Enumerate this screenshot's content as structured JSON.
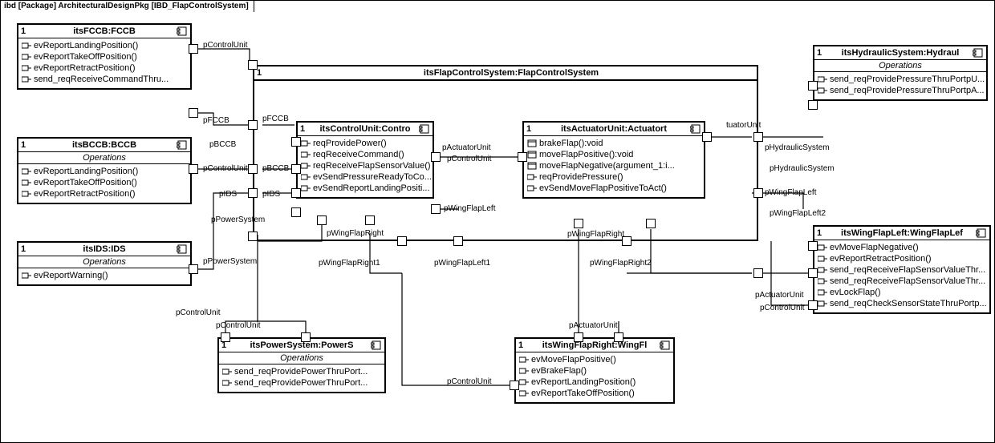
{
  "header": "ibd [Package] ArchitecturalDesignPkg [IBD_FlapControlSystem]",
  "frame": {
    "mult": "1",
    "title": "itsFlapControlSystem:FlapControlSystem"
  },
  "blocks": {
    "fccb": {
      "mult": "1",
      "title": "itsFCCB:FCCB",
      "ops": [
        "evReportLandingPosition()",
        "evReportTakeOffPosition()",
        "evReportRetractPosition()",
        "send_reqReceiveCommandThru..."
      ]
    },
    "bccb": {
      "mult": "1",
      "title": "itsBCCB:BCCB",
      "ops_header": "Operations",
      "ops": [
        "evReportLandingPosition()",
        "evReportTakeOffPosition()",
        "evReportRetractPosition()"
      ]
    },
    "ids": {
      "mult": "1",
      "title": "itsIDS:IDS",
      "ops_header": "Operations",
      "ops": [
        "evReportWarning()"
      ]
    },
    "controlunit": {
      "mult": "1",
      "title": "itsControlUnit:Contro",
      "ops": [
        "reqProvidePower()",
        "reqReceiveCommand()",
        "reqReceiveFlapSensorValue()",
        "evSendPressureReadyToCo...",
        "evSendReportLandingPositi..."
      ]
    },
    "actuator": {
      "mult": "1",
      "title": "itsActuatorUnit:Actuatort",
      "ops": [
        "brakeFlap():void",
        "moveFlapPositive():void",
        "moveFlapNegative(argument_1:i...",
        "reqProvidePressure()",
        "evSendMoveFlapPositiveToAct()"
      ]
    },
    "hydraulic": {
      "mult": "1",
      "title": "itsHydraulicSystem:Hydraul",
      "ops_header": "Operations",
      "ops": [
        "send_reqProvidePressureThruPortpU...",
        "send_reqProvidePressureThruPortpA..."
      ]
    },
    "wingflapleft": {
      "mult": "1",
      "title": "itsWingFlapLeft:WingFlapLef",
      "ops": [
        "evMoveFlapNegative()",
        "evReportRetractPosition()",
        "send_reqReceiveFlapSensorValueThr...",
        "send_reqReceiveFlapSensorValueThr...",
        "evLockFlap()",
        "send_reqCheckSensorStateThruPortp..."
      ]
    },
    "powersystem": {
      "mult": "1",
      "title": "itsPowerSystem:PowerS",
      "ops_header": "Operations",
      "ops": [
        "send_reqProvidePowerThruPort...",
        "send_reqProvidePowerThruPort..."
      ]
    },
    "wingflapright": {
      "mult": "1",
      "title": "itsWingFlapRight:WingFl",
      "ops": [
        "evMoveFlapPositive()",
        "evBrakeFlap()",
        "evReportLandingPosition()",
        "evReportTakeOffPosition()"
      ]
    }
  },
  "port_labels": {
    "pControlUnit": "pControlUnit",
    "pFCCB": "pFCCB",
    "pBCCB": "pBCCB",
    "pIDS": "pIDS",
    "pPowerSystem": "pPowerSystem",
    "pActuatorUnit": "pActuatorUnit",
    "pHydraulicSystem": "pHydraulicSystem",
    "pWingFlapLeft": "pWingFlapLeft",
    "pWingFlapLeft1": "pWingFlapLeft1",
    "pWingFlapLeft2": "pWingFlapLeft2",
    "pWingFlapRight": "pWingFlapRight",
    "pWingFlapRight1": "pWingFlapRight1",
    "pWingFlapRight2": "pWingFlapRight2",
    "tuatorUnit": "tuatorUnit"
  }
}
